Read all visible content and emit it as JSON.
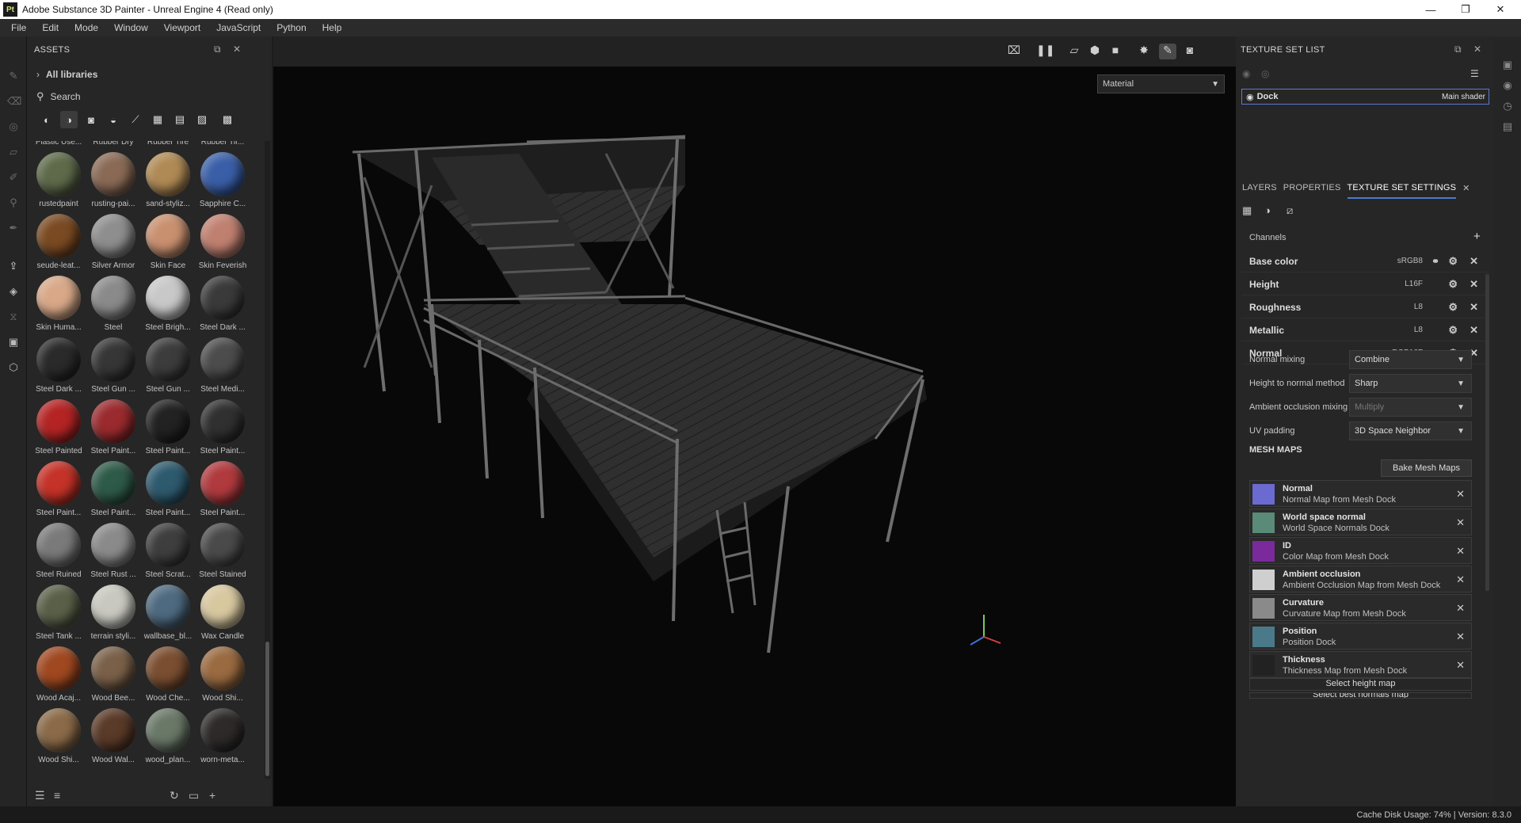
{
  "titlebar": {
    "title": "Adobe Substance 3D Painter - Unreal Engine 4 (Read only)",
    "logo": "Pt"
  },
  "menu": [
    "File",
    "Edit",
    "Mode",
    "Window",
    "Viewport",
    "JavaScript",
    "Python",
    "Help"
  ],
  "assets": {
    "title": "ASSETS",
    "libraries": "All libraries",
    "search_placeholder": "Search",
    "items": [
      {
        "label": "Plastic Use...",
        "color": "#6e5a4a"
      },
      {
        "label": "Rubber Dry",
        "color": "#5a4a42"
      },
      {
        "label": "Rubber Tire",
        "color": "#4a4440"
      },
      {
        "label": "Rubber Tir...",
        "color": "#504540"
      },
      {
        "label": "rustedpaint",
        "color": "#5e6a4a"
      },
      {
        "label": "rusting-pai...",
        "color": "#8a6a55"
      },
      {
        "label": "sand-styliz...",
        "color": "#b08a55"
      },
      {
        "label": "Sapphire C...",
        "color": "#3a5fa8"
      },
      {
        "label": "seude-leat...",
        "color": "#7a4a22"
      },
      {
        "label": "Silver Armor",
        "color": "#8e8e8e"
      },
      {
        "label": "Skin Face",
        "color": "#c99070"
      },
      {
        "label": "Skin Feverish",
        "color": "#c08070"
      },
      {
        "label": "Skin Huma...",
        "color": "#d8a888"
      },
      {
        "label": "Steel",
        "color": "#8a8a8a"
      },
      {
        "label": "Steel Brigh...",
        "color": "#c8c8c8"
      },
      {
        "label": "Steel Dark ...",
        "color": "#3a3a3a"
      },
      {
        "label": "Steel Dark ...",
        "color": "#2a2a2a"
      },
      {
        "label": "Steel Gun ...",
        "color": "#363636"
      },
      {
        "label": "Steel Gun ...",
        "color": "#3c3c3c"
      },
      {
        "label": "Steel Medi...",
        "color": "#4c4c4c"
      },
      {
        "label": "Steel Painted",
        "color": "#b42424"
      },
      {
        "label": "Steel Paint...",
        "color": "#9a2a2e"
      },
      {
        "label": "Steel Paint...",
        "color": "#222222"
      },
      {
        "label": "Steel Paint...",
        "color": "#303030"
      },
      {
        "label": "Steel Paint...",
        "color": "#c43228"
      },
      {
        "label": "Steel Paint...",
        "color": "#2e5a48"
      },
      {
        "label": "Steel Paint...",
        "color": "#2e5a6e"
      },
      {
        "label": "Steel Paint...",
        "color": "#b03a3e"
      },
      {
        "label": "Steel Ruined",
        "color": "#7a7a7a"
      },
      {
        "label": "Steel Rust ...",
        "color": "#8a8a8a"
      },
      {
        "label": "Steel Scrat...",
        "color": "#3e3e3e"
      },
      {
        "label": "Steel Stained",
        "color": "#4a4a4a"
      },
      {
        "label": "Steel Tank ...",
        "color": "#5a6048"
      },
      {
        "label": "terrain styli...",
        "color": "#c8c8c0"
      },
      {
        "label": "wallbase_bl...",
        "color": "#4e6a80"
      },
      {
        "label": "Wax Candle",
        "color": "#d8c8a0"
      },
      {
        "label": "Wood Acaj...",
        "color": "#a04820"
      },
      {
        "label": "Wood Bee...",
        "color": "#7a6048"
      },
      {
        "label": "Wood Che...",
        "color": "#7a4e30"
      },
      {
        "label": "Wood Shi...",
        "color": "#9a6a40"
      },
      {
        "label": "Wood Shi...",
        "color": "#8a6a48"
      },
      {
        "label": "Wood Wal...",
        "color": "#5a3a28"
      },
      {
        "label": "wood_plan...",
        "color": "#6a7868"
      },
      {
        "label": "worn-meta...",
        "color": "#2e2a2a"
      }
    ]
  },
  "viewport": {
    "material_select": "Material"
  },
  "texture_set_list": {
    "title": "TEXTURE SET LIST",
    "set_name": "Dock",
    "shader": "Main shader"
  },
  "tabs": {
    "layers": "LAYERS",
    "properties": "PROPERTIES",
    "tss": "TEXTURE SET SETTINGS"
  },
  "channels": {
    "label": "Channels",
    "items": [
      {
        "name": "Base color",
        "format": "sRGB8"
      },
      {
        "name": "Height",
        "format": "L16F"
      },
      {
        "name": "Roughness",
        "format": "L8"
      },
      {
        "name": "Metallic",
        "format": "L8"
      },
      {
        "name": "Normal",
        "format": "RGB16F"
      }
    ]
  },
  "settings": [
    {
      "label": "Normal mixing",
      "value": "Combine"
    },
    {
      "label": "Height to normal method",
      "value": "Sharp"
    },
    {
      "label": "Ambient occlusion mixing",
      "value": "Multiply"
    },
    {
      "label": "UV padding",
      "value": "3D Space Neighbor"
    }
  ],
  "mesh_maps": {
    "title": "MESH MAPS",
    "bake_button": "Bake Mesh Maps",
    "items": [
      {
        "name": "Normal",
        "desc": "Normal Map from Mesh Dock",
        "color": "#6a6ad0"
      },
      {
        "name": "World space normal",
        "desc": "World Space Normals Dock",
        "color": "#5a8a78"
      },
      {
        "name": "ID",
        "desc": "Color Map from Mesh Dock",
        "color": "#7a2a9a"
      },
      {
        "name": "Ambient occlusion",
        "desc": "Ambient Occlusion Map from Mesh Dock",
        "color": "#cfcfcf"
      },
      {
        "name": "Curvature",
        "desc": "Curvature Map from Mesh Dock",
        "color": "#8a8a8a"
      },
      {
        "name": "Position",
        "desc": "Position Dock",
        "color": "#4a7a8a"
      },
      {
        "name": "Thickness",
        "desc": "Thickness Map from Mesh Dock",
        "color": "#222222"
      }
    ],
    "select_height": "Select height map",
    "select_next": "Select best normals map"
  },
  "status": {
    "text": "Cache Disk Usage:   74% | Version: 8.3.0"
  }
}
